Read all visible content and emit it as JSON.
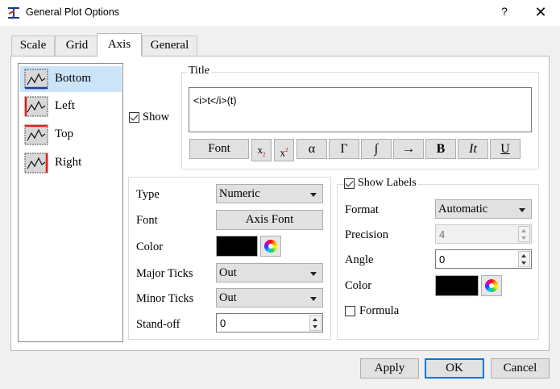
{
  "window": {
    "title": "General Plot Options",
    "help_glyph": "?",
    "close_glyph": "✕"
  },
  "tabs": [
    {
      "label": "Scale",
      "active": false
    },
    {
      "label": "Grid",
      "active": false
    },
    {
      "label": "Axis",
      "active": true
    },
    {
      "label": "General",
      "active": false
    }
  ],
  "axes": [
    {
      "label": "Bottom",
      "icon": "axis-bottom-icon",
      "selected": true
    },
    {
      "label": "Left",
      "icon": "axis-left-icon",
      "selected": false
    },
    {
      "label": "Top",
      "icon": "axis-top-icon",
      "selected": false
    },
    {
      "label": "Right",
      "icon": "axis-right-icon",
      "selected": false
    }
  ],
  "show": {
    "label": "Show",
    "checked": true
  },
  "title_group": {
    "legend": "Title",
    "value": "<i>t</i>(t)",
    "font_button": "Font",
    "buttons": {
      "subscript": {
        "base": "x",
        "mark": "2"
      },
      "superscript": {
        "base": "x",
        "mark": "2"
      },
      "alpha": "α",
      "gamma": "Γ",
      "integral": "∫",
      "arrow": "→",
      "bold": "B",
      "italic": "It",
      "underline": "U"
    }
  },
  "axis_props": {
    "type_label": "Type",
    "type_value": "Numeric",
    "font_label": "Font",
    "font_button": "Axis Font",
    "color_label": "Color",
    "color_value": "#000000",
    "major_label": "Major Ticks",
    "major_value": "Out",
    "minor_label": "Minor Ticks",
    "minor_value": "Out",
    "standoff_label": "Stand-off",
    "standoff_value": "0"
  },
  "labels_group": {
    "show_labels": {
      "label": "Show Labels",
      "checked": true
    },
    "format_label": "Format",
    "format_value": "Automatic",
    "precision_label": "Precision",
    "precision_value": "4",
    "angle_label": "Angle",
    "angle_value": "0",
    "color_label": "Color",
    "color_value": "#000000",
    "formula": {
      "label": "Formula",
      "checked": false
    }
  },
  "footer": {
    "apply": "Apply",
    "ok": "OK",
    "cancel": "Cancel"
  },
  "colors": {
    "accent": "#0078d7",
    "selection": "#cce4f7",
    "axis_highlight": "#e02020"
  }
}
